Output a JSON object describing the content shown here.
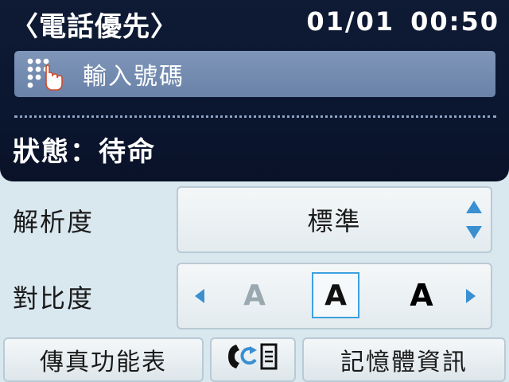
{
  "header": {
    "title": "〈電話優先〉",
    "date": "01/01",
    "time": "00:50",
    "input_button": {
      "label": "輸入號碼",
      "icon": "keypad-icon"
    },
    "status": "狀態：待命"
  },
  "settings": {
    "resolution": {
      "label": "解析度",
      "value": "標準",
      "icon": "up-down-arrows-icon"
    },
    "contrast": {
      "label": "對比度",
      "options": [
        "A",
        "A",
        "A"
      ],
      "selected": "medium",
      "selected_index": 1
    }
  },
  "bottom": {
    "fax_menu": "傳真功能表",
    "hook_icon": "on-hook-dial-icon",
    "memory_info": "記憶體資訊"
  },
  "colors": {
    "header_bg": "#0b1630",
    "input_bar": "#7388ac",
    "panel_bg": "#d9e7ef",
    "accent_blue": "#3ea0e0"
  }
}
